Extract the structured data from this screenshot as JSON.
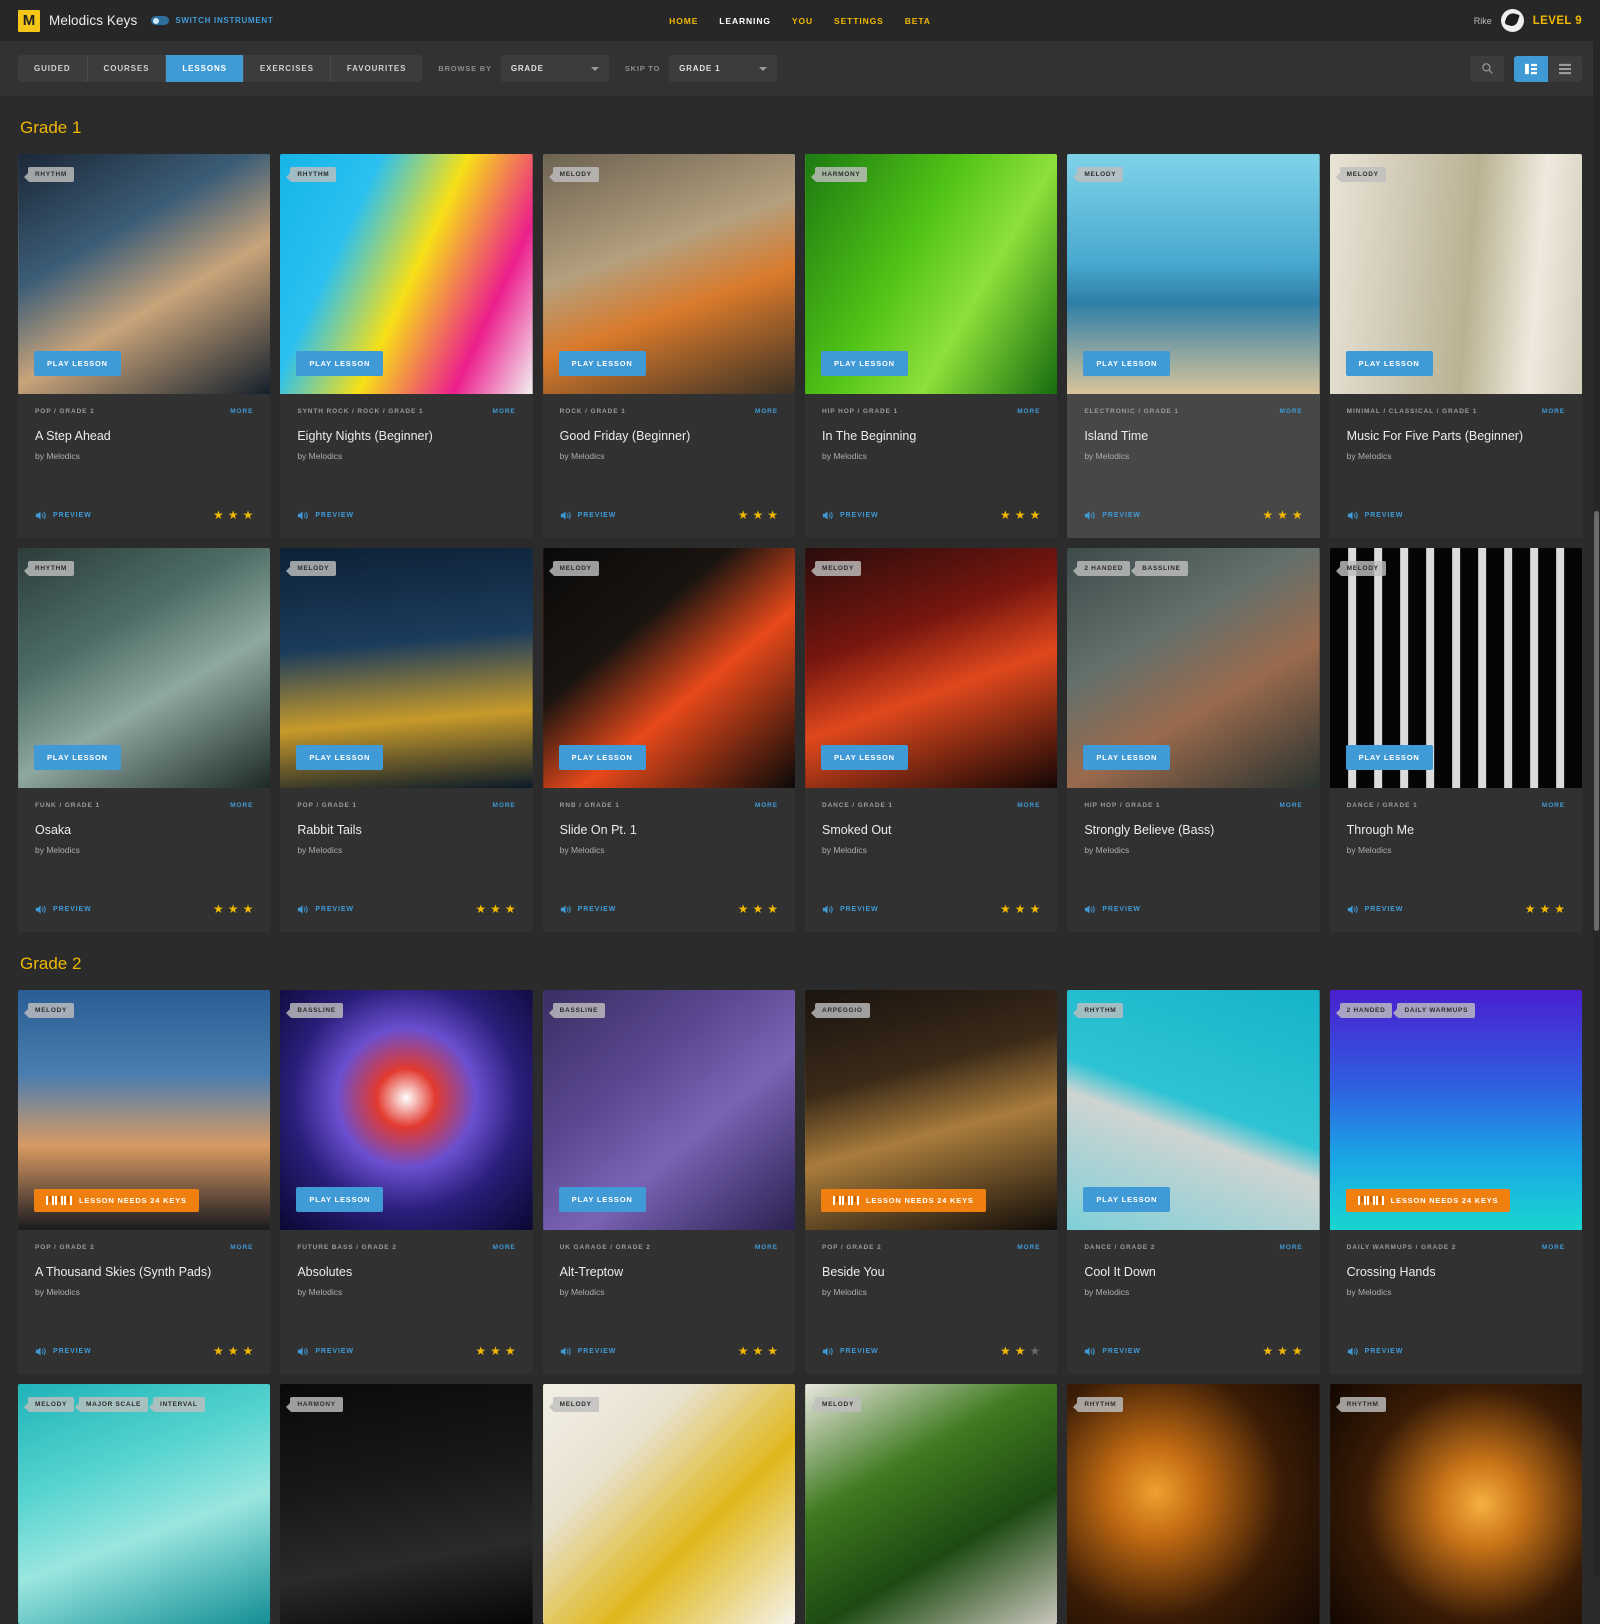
{
  "topbar": {
    "logo_letter": "M",
    "brand": "Melodics Keys",
    "switch_instrument": "SWITCH INSTRUMENT",
    "nav": [
      {
        "label": "HOME",
        "active": false
      },
      {
        "label": "LEARNING",
        "active": true
      },
      {
        "label": "YOU",
        "active": false
      },
      {
        "label": "SETTINGS",
        "active": false
      },
      {
        "label": "BETA",
        "active": false
      }
    ],
    "user_name": "Rike",
    "level": "LEVEL 9"
  },
  "toolbar": {
    "segments": [
      {
        "label": "GUIDED",
        "active": false
      },
      {
        "label": "COURSES",
        "active": false
      },
      {
        "label": "LESSONS",
        "active": true
      },
      {
        "label": "EXERCISES",
        "active": false
      },
      {
        "label": "FAVOURITES",
        "active": false
      }
    ],
    "browse_by_label": "BROWSE BY",
    "browse_by_value": "GRADE",
    "skip_to_label": "SKIP TO",
    "skip_to_value": "GRADE 1",
    "search_icon": "search-icon",
    "grid_view_icon": "grid-view-icon",
    "list_view_icon": "list-view-icon",
    "grid_view_active": true
  },
  "labels": {
    "play_lesson": "PLAY LESSON",
    "needs_keys": "LESSON NEEDS 24 KEYS",
    "more": "MORE",
    "preview": "PREVIEW",
    "author": "by Melodics"
  },
  "colors": {
    "accent_blue": "#3f9ad6",
    "accent_yellow": "#f0b800",
    "accent_orange": "#ef7f0f",
    "page_bg": "#2b2b2b",
    "card_bg": "#313131",
    "card_bg_hover": "#474747"
  },
  "sections": [
    {
      "heading": "Grade 1",
      "cards": [
        {
          "title": "A Step Ahead",
          "author": "by Melodics",
          "category": "POP / GRADE 1",
          "badges": [
            "RHYTHM"
          ],
          "button": "play",
          "stars": 3,
          "hovered": false,
          "image": "linear-gradient(150deg,#1b2736 0%,#3c5d77 35%,#c9a47a 60%,#15202c 100%)"
        },
        {
          "title": "Eighty Nights (Beginner)",
          "author": "by Melodics",
          "category": "SYNTH ROCK / ROCK / GRADE 1",
          "badges": [
            "RHYTHM"
          ],
          "button": "play",
          "stars": 0,
          "hovered": false,
          "image": "linear-gradient(115deg,#15b5e8 0%,#2bc0f0 28%,#f7e017 52%,#ec1e8c 78%,#f2f2f2 100%)"
        },
        {
          "title": "Good Friday (Beginner)",
          "author": "by Melodics",
          "category": "ROCK / GRADE 1",
          "badges": [
            "MELODY"
          ],
          "button": "play",
          "stars": 3,
          "hovered": false,
          "image": "linear-gradient(160deg,#6d6252 0%,#b4a07e 40%,#d97a2b 62%,#3b3125 100%)"
        },
        {
          "title": "In The Beginning",
          "author": "by Melodics",
          "category": "HIP HOP / GRADE 1",
          "badges": [
            "HARMONY"
          ],
          "button": "play",
          "stars": 3,
          "hovered": false,
          "image": "linear-gradient(120deg,#1d7a12 0%,#4fc216 40%,#8ee03a 65%,#176b0e 100%)"
        },
        {
          "title": "Island Time",
          "author": "by Melodics",
          "category": "ELECTRONIC / GRADE 1",
          "badges": [
            "MELODY"
          ],
          "button": "play",
          "stars": 3,
          "hovered": true,
          "image": "linear-gradient(180deg,#7fd3e8 0%,#49a9cf 45%,#2f7fa8 62%,#d9c49a 100%)"
        },
        {
          "title": "Music For Five Parts (Beginner)",
          "author": "by Melodics",
          "category": "MINIMAL / CLASSICAL / GRADE 1",
          "badges": [
            "MELODY"
          ],
          "button": "play",
          "stars": 0,
          "hovered": false,
          "image": "linear-gradient(95deg,#e9e4d6 0%,#cfc8b4 30%,#b9b292 55%,#efeade 80%,#d3cdbb 100%)"
        },
        {
          "title": "Osaka",
          "author": "by Melodics",
          "category": "FUNK / GRADE 1",
          "badges": [
            "RHYTHM"
          ],
          "button": "play",
          "stars": 3,
          "hovered": false,
          "image": "linear-gradient(150deg,#2c3c3a 0%,#4e6d66 35%,#8fa8a0 60%,#1d2a28 100%)"
        },
        {
          "title": "Rabbit Tails",
          "author": "by Melodics",
          "category": "POP / GRADE 1",
          "badges": [
            "MELODY"
          ],
          "button": "play",
          "stars": 3,
          "hovered": false,
          "image": "linear-gradient(175deg,#0d2136 0%,#1c3c5c 40%,#c79a2a 70%,#0b1a29 100%)"
        },
        {
          "title": "Slide On Pt. 1",
          "author": "by Melodics",
          "category": "RNB / GRADE 1",
          "badges": [
            "MELODY"
          ],
          "button": "play",
          "stars": 3,
          "hovered": false,
          "image": "linear-gradient(140deg,#0a0a0a 0%,#1a1410 35%,#e8491a 60%,#090909 100%)"
        },
        {
          "title": "Smoked Out",
          "author": "by Melodics",
          "category": "DANCE / GRADE 1",
          "badges": [
            "MELODY"
          ],
          "button": "play",
          "stars": 3,
          "hovered": false,
          "image": "linear-gradient(160deg,#2a0d0c 0%,#77160f 35%,#e0481d 58%,#140605 100%)"
        },
        {
          "title": "Strongly Believe (Bass)",
          "author": "by Melodics",
          "category": "HIP HOP / GRADE 1",
          "badges": [
            "2 HANDED",
            "BASSLINE"
          ],
          "button": "play",
          "stars": 0,
          "hovered": false,
          "image": "linear-gradient(150deg,#3c4a4a 0%,#62706c 35%,#9a6a4d 62%,#28322f 100%)"
        },
        {
          "title": "Through Me",
          "author": "by Melodics",
          "category": "DANCE / GRADE 1",
          "badges": [
            "MELODY"
          ],
          "button": "play",
          "stars": 3,
          "hovered": false,
          "image": "repeating-linear-gradient(90deg,#050505 0px,#050505 18px,#dcdcdc 18px,#dcdcdc 26px)"
        }
      ]
    },
    {
      "heading": "Grade 2",
      "cards": [
        {
          "title": "A Thousand Skies (Synth Pads)",
          "author": "by Melodics",
          "category": "POP / GRADE 2",
          "badges": [
            "MELODY"
          ],
          "button": "needs",
          "stars": 3,
          "hovered": false,
          "image": "linear-gradient(180deg,#2a5d94 0%,#4a7db0 35%,#d89a63 65%,#1a1a20 100%)"
        },
        {
          "title": "Absolutes",
          "author": "by Melodics",
          "category": "FUTURE BASS / GRADE 2",
          "badges": [
            "BASSLINE"
          ],
          "button": "play",
          "stars": 3,
          "hovered": false,
          "image": "radial-gradient(circle at 50% 45%,#ffffff 0%,#e23a2f 16%,#6a4fd0 38%,#2a1e7a 62%,#0a0730 100%)"
        },
        {
          "title": "Alt-Treptow",
          "author": "by Melodics",
          "category": "UK GARAGE / GRADE 2",
          "badges": [
            "BASSLINE"
          ],
          "button": "play",
          "stars": 3,
          "hovered": false,
          "image": "linear-gradient(140deg,#3a2e63 0%,#5b4790 35%,#7a63b5 60%,#2b2150 100%)"
        },
        {
          "title": "Beside You",
          "author": "by Melodics",
          "category": "POP / GRADE 2",
          "badges": [
            "ARPEGGIO"
          ],
          "button": "needs",
          "stars": 2,
          "hovered": false,
          "image": "linear-gradient(165deg,#1a1410 0%,#3b2a18 35%,#a97c3c 58%,#120d09 100%)"
        },
        {
          "title": "Cool It Down",
          "author": "by Melodics",
          "category": "DANCE / GRADE 2",
          "badges": [
            "RHYTHM"
          ],
          "button": "play",
          "stars": 3,
          "hovered": false,
          "image": "linear-gradient(200deg,#16b3c8 0%,#2ec3d4 48%,#cfd4d2 58%,#7fd0d8 100%)"
        },
        {
          "title": "Crossing Hands",
          "author": "by Melodics",
          "category": "DAILY WARMUPS / GRADE 2",
          "badges": [
            "2 HANDED",
            "DAILY WARMUPS"
          ],
          "button": "needs",
          "stars": 0,
          "hovered": false,
          "image": "linear-gradient(180deg,#4a1fd0 0%,#2f5fe0 40%,#1aa6e6 70%,#17d6cf 100%)"
        },
        {
          "title": "",
          "author": "",
          "category": "",
          "badges": [
            "MELODY",
            "MAJOR SCALE",
            "INTERVAL"
          ],
          "button": "none",
          "stars": 0,
          "hovered": false,
          "image": "linear-gradient(160deg,#1fb3b8 0%,#57d4d0 35%,#9ae6df 60%,#148f96 100%)"
        },
        {
          "title": "",
          "author": "",
          "category": "",
          "badges": [
            "HARMONY"
          ],
          "button": "none",
          "stars": 0,
          "hovered": false,
          "image": "linear-gradient(170deg,#0a0a0a 0%,#181818 40%,#2a2a2a 70%,#060606 100%)"
        },
        {
          "title": "",
          "author": "",
          "category": "",
          "badges": [
            "MELODY"
          ],
          "button": "none",
          "stars": 0,
          "hovered": false,
          "image": "linear-gradient(135deg,#f2efe6 0%,#e8e2d0 30%,#e0b81c 62%,#f5f2ea 100%)"
        },
        {
          "title": "",
          "author": "",
          "category": "",
          "badges": [
            "MELODY"
          ],
          "button": "none",
          "stars": 0,
          "hovered": false,
          "image": "linear-gradient(150deg,#e8e6de 0%,#3f7a20 35%,#1d4a12 65%,#c9c6bb 100%)"
        },
        {
          "title": "",
          "author": "",
          "category": "",
          "badges": [
            "RHYTHM"
          ],
          "button": "none",
          "stars": 0,
          "hovered": false,
          "image": "radial-gradient(circle at 35% 45%,#f0a030 0%,#c06a12 22%,#3a1c06 60%,#140802 100%)"
        },
        {
          "title": "",
          "author": "",
          "category": "",
          "badges": [
            "RHYTHM"
          ],
          "button": "none",
          "stars": 0,
          "hovered": false,
          "image": "radial-gradient(circle at 60% 50%,#f5b040 0%,#c97418 22%,#3a1c06 60%,#120701 100%)"
        }
      ]
    }
  ]
}
